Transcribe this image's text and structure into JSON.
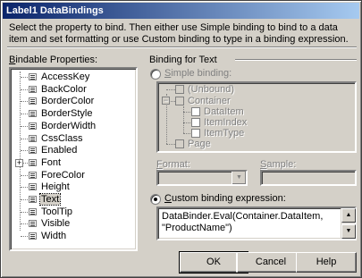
{
  "window": {
    "title": "Label1 DataBindings"
  },
  "description": "Select the property to bind. Then either use Simple binding to bind to a data item and set formatting or use Custom binding to type in a binding expression.",
  "bindable": {
    "label_prefix": "B",
    "label_rest": "indable Properties:",
    "items": [
      {
        "label": "AccessKey"
      },
      {
        "label": "BackColor"
      },
      {
        "label": "BorderColor"
      },
      {
        "label": "BorderStyle"
      },
      {
        "label": "BorderWidth"
      },
      {
        "label": "CssClass"
      },
      {
        "label": "Enabled"
      },
      {
        "label": "Font",
        "expander": "+"
      },
      {
        "label": "ForeColor"
      },
      {
        "label": "Height"
      },
      {
        "label": "Text",
        "selected": true
      },
      {
        "label": "ToolTip"
      },
      {
        "label": "Visible"
      },
      {
        "label": "Width"
      }
    ]
  },
  "binding_group": {
    "title": "Binding for Text"
  },
  "simple": {
    "label_prefix": "S",
    "label_rest": "imple binding:",
    "tree": {
      "unbound": "(Unbound)",
      "container": "Container",
      "container_expander": "−",
      "children": [
        "DataItem",
        "ItemIndex",
        "ItemType"
      ],
      "page": "Page"
    }
  },
  "format": {
    "label_prefix": "F",
    "label_rest": "ormat:"
  },
  "sample": {
    "label_prefix": "S",
    "label_rest": "ample:"
  },
  "custom": {
    "label_prefix": "C",
    "label_rest": "ustom binding expression:",
    "expression": "DataBinder.Eval(Container.DataItem,\n\"ProductName\")"
  },
  "buttons": {
    "ok": "OK",
    "cancel": "Cancel",
    "help": "Help"
  }
}
